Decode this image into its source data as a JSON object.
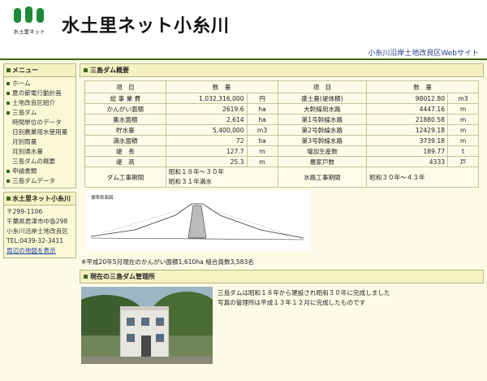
{
  "header": {
    "title": "水土里ネット小糸川",
    "subtitle": "小糸川沿岸土地改良区Webサイト",
    "logo_text": "水土里ネット"
  },
  "sidebar": {
    "menu_heading": "メニュー",
    "menu": [
      {
        "label": "ホーム",
        "level": 1
      },
      {
        "label": "夏の節電行動計画",
        "level": 1
      },
      {
        "label": "土地改良区紹介",
        "level": 1
      },
      {
        "label": "三島ダム",
        "level": 1
      },
      {
        "label": "時間単位のデータ",
        "level": 2
      },
      {
        "label": "日別農業用水使用量",
        "level": 2
      },
      {
        "label": "月別雨量",
        "level": 2
      },
      {
        "label": "月別通水量",
        "level": 2
      },
      {
        "label": "三島ダムの概要",
        "level": 2
      },
      {
        "label": "申請書類",
        "level": 1
      },
      {
        "label": "三島ダムデータ",
        "level": 1
      }
    ],
    "contact_heading": "水土里ネット小糸川",
    "contact": {
      "zip": "〒299-1106",
      "addr1": "千葉県君津市中島298",
      "addr2": "小糸川沿岸土地改良区",
      "tel": "TEL:0439-32-3411",
      "map_link": "周辺の地図を表示"
    }
  },
  "main": {
    "section1": "三島ダム概要",
    "table": {
      "headers": [
        "項　目",
        "数　量",
        "",
        "項　目",
        "数　量",
        ""
      ],
      "rows": [
        [
          "総 事 業 費",
          "1,032,316,000",
          "円",
          "盛土量(堤体積)",
          "98012.80",
          "m3"
        ],
        [
          "かんがい面積",
          "2619.6",
          "ha",
          "大幹線用水路",
          "4447.16",
          "m"
        ],
        [
          "集水面積",
          "2,614",
          "ha",
          "第1号幹線水路",
          "21880.58",
          "m"
        ],
        [
          "貯水量",
          "5,400,000",
          "m3",
          "第2号幹線水路",
          "12429.18",
          "m"
        ],
        [
          "満水面積",
          "72",
          "ha",
          "第3号幹線水路",
          "3739.18",
          "m"
        ],
        [
          "堤　長",
          "127.7",
          "m",
          "増加生産数",
          "189.77",
          "t"
        ],
        [
          "堤　高",
          "25.3",
          "m",
          "農家戸数",
          "4333",
          "戸"
        ]
      ],
      "period_label": "ダム工事期間",
      "period_value1": "昭和１８年～３０年",
      "period_value2": "昭和３１年満水",
      "channel_label": "水路工事期間",
      "channel_value": "昭和３０年～４３年"
    },
    "diagram_title": "標準断面図",
    "note": "※平成20年5月現在のかんがい面積1,610ha 組合員数3,583名",
    "section2": "現在の三島ダム管理所",
    "photo_text1": "三島ダムは昭和１８年から建設され昭和３０年に完成しました",
    "photo_text2": "写真の管理所は平成１３年１２月に完成したものです"
  },
  "colors": {
    "accent": "#3b6a1c",
    "link": "#1a3fa0",
    "bg": "#fdfbe6"
  }
}
